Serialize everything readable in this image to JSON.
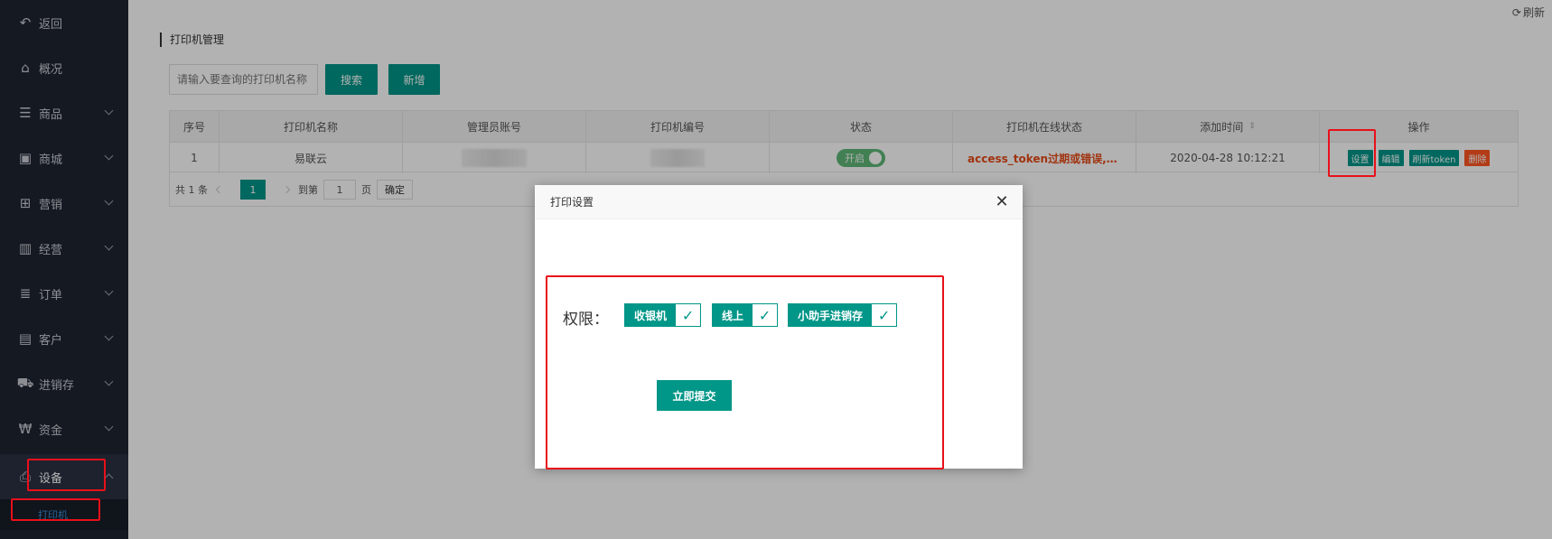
{
  "sidebar": {
    "items": [
      {
        "label": "返回",
        "icon": "back-arrow-icon",
        "glyph": "↶"
      },
      {
        "label": "概况",
        "icon": "home-icon",
        "glyph": "⌂"
      },
      {
        "label": "商品",
        "icon": "list-icon",
        "glyph": "☰"
      },
      {
        "label": "商城",
        "icon": "shopping-bag-icon",
        "glyph": "▣"
      },
      {
        "label": "营销",
        "icon": "gift-icon",
        "glyph": "⊞"
      },
      {
        "label": "经营",
        "icon": "bar-chart-icon",
        "glyph": "▥"
      },
      {
        "label": "订单",
        "icon": "list-bullets-icon",
        "glyph": "≣"
      },
      {
        "label": "客户",
        "icon": "contact-card-icon",
        "glyph": "▤"
      },
      {
        "label": "进销存",
        "icon": "truck-icon",
        "glyph": "⛟"
      },
      {
        "label": "资金",
        "icon": "won-currency-icon",
        "glyph": "₩"
      },
      {
        "label": "设备",
        "icon": "printer-icon",
        "glyph": "⎙"
      }
    ],
    "sub_item": "打印机"
  },
  "header": {
    "refresh_label": "刷新",
    "page_title": "打印机管理"
  },
  "toolbar": {
    "search_placeholder": "请输入要查询的打印机名称",
    "search_label": "搜索",
    "add_label": "新增"
  },
  "table": {
    "columns": [
      "序号",
      "打印机名称",
      "管理员账号",
      "打印机编号",
      "状态",
      "打印机在线状态",
      "添加时间",
      "操作"
    ],
    "rows": [
      {
        "index": "1",
        "name": "易联云",
        "status_switch": "开启",
        "online_status": "access_token过期或错误,请...",
        "added_time": "2020-04-28 10:12:21",
        "actions": [
          "设置",
          "编辑",
          "刷新token",
          "删除"
        ]
      }
    ]
  },
  "pager": {
    "total": "共 1 条",
    "current": "1",
    "goto_label": "到第",
    "goto_value": "1",
    "page_unit": "页",
    "confirm": "确定"
  },
  "dialog": {
    "title": "打印设置",
    "close_glyph": "✕",
    "permission_label": "权限：",
    "checkboxes": [
      "收银机",
      "线上",
      "小助手进销存"
    ],
    "check_glyph": "✓",
    "submit_label": "立即提交"
  },
  "colors": {
    "accent": "#009688",
    "sidebar_bg": "#1f2532",
    "danger": "#ff5722",
    "error_text": "#e54a16",
    "annotation": "#e8101a"
  }
}
